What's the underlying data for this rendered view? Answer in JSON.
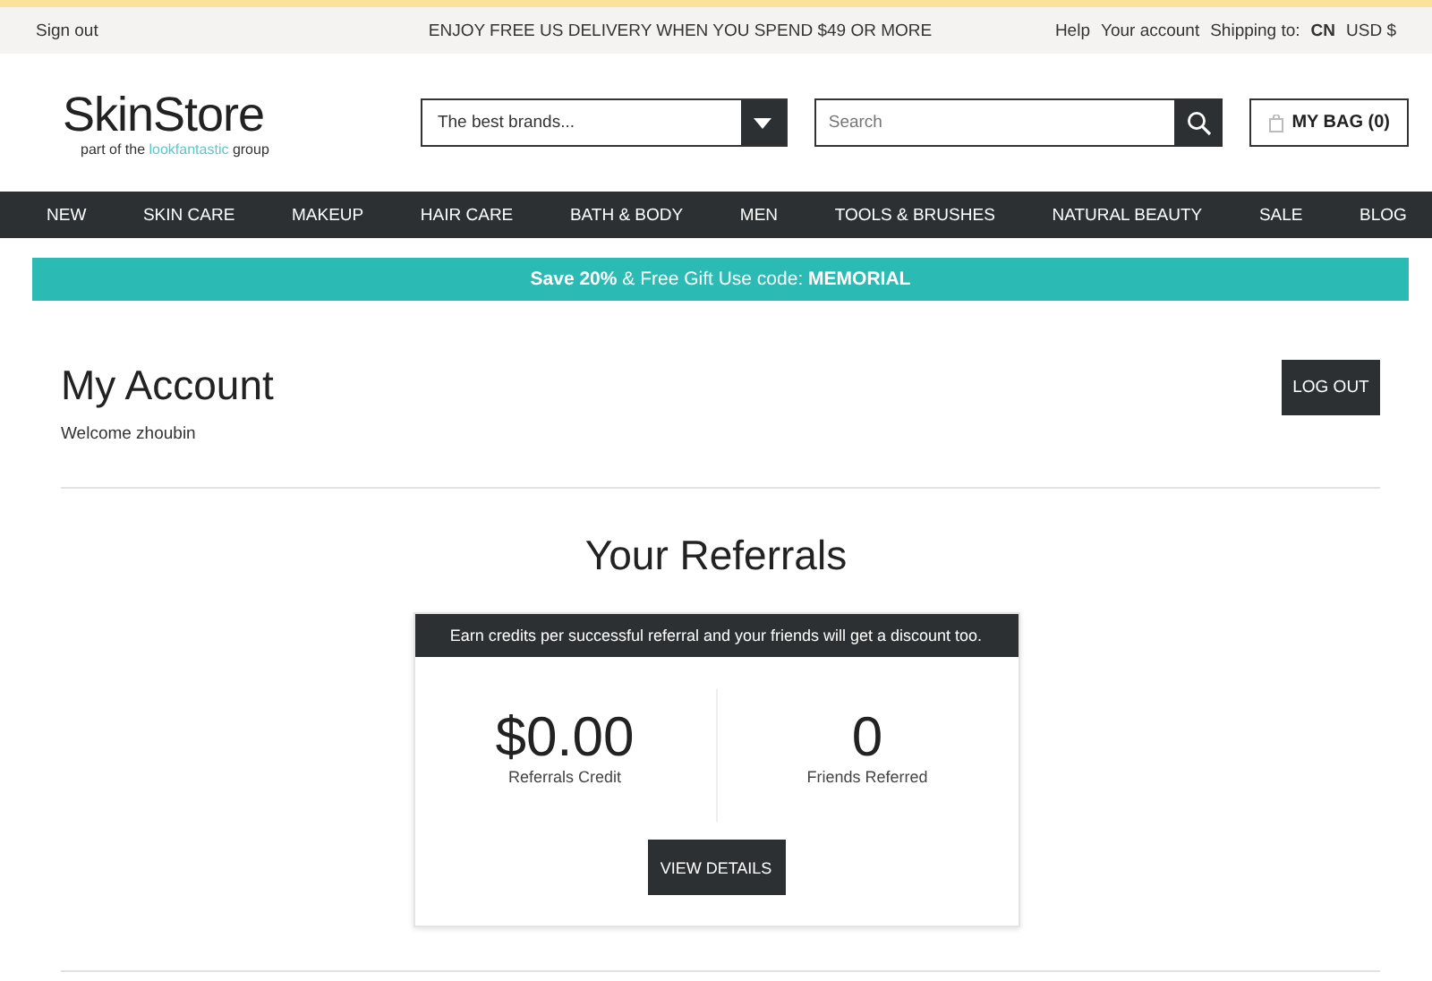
{
  "top_bar": {
    "sign_out": "Sign out",
    "message": "ENJOY FREE US DELIVERY WHEN YOU SPEND $49 OR MORE",
    "links": [
      "Help",
      "Your account"
    ],
    "shipping_label": "Shipping to:",
    "shipping_country": "CN",
    "currency": "USD $"
  },
  "header": {
    "logo": "SkinStore",
    "tagline_before": "part of the",
    "tagline_brand": "lookfantastic",
    "tagline_after": "group",
    "brand_select": {
      "value": "The best brands..."
    },
    "search": {
      "placeholder": "Search"
    },
    "bag": "MY BAG (0)"
  },
  "nav": [
    "NEW",
    "SKIN CARE",
    "MAKEUP",
    "HAIR CARE",
    "BATH & BODY",
    "MEN",
    "TOOLS & BRUSHES",
    "NATURAL BEAUTY",
    "SALE",
    "BLOG"
  ],
  "promo": "**Save 20%** & Free Gift Use code: **MEMORIAL**",
  "account": {
    "title": "My Account",
    "welcome": "Welcome zhoubin",
    "logout": "LOG OUT"
  },
  "referrals": {
    "title": "Your Referrals",
    "banner": "Earn credits per successful referral and your friends will get a discount too.",
    "stats": [
      {
        "value": "$0.00",
        "label": "Referrals Credit"
      },
      {
        "value": "0",
        "label": "Friends Referred"
      }
    ],
    "button": "VIEW DETAILS"
  }
}
